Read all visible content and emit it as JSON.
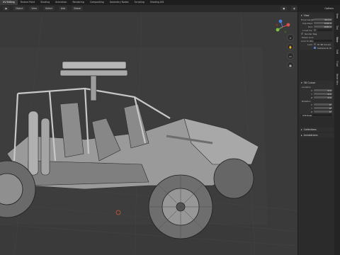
{
  "topbar": {
    "tabs": [
      "UV Editing",
      "Texture Paint",
      "Shading",
      "Animation",
      "Rendering",
      "Compositing",
      "Geometry Nodes",
      "Scripting",
      "Shading.001"
    ],
    "active_index": 0
  },
  "viewport_header": {
    "mode": "Global",
    "chips": [
      "Object",
      "View",
      "Select",
      "Add"
    ]
  },
  "npanel": {
    "header": "Options",
    "view": {
      "title": "View",
      "focal_length_label": "Focal Length",
      "focal_length": "50 mm",
      "clip_start_label": "Clip Start",
      "clip_start": "0.01 m",
      "clip_end_label": "End",
      "clip_end": "1000 m",
      "local_camera_label": "Local Ca.",
      "render_region_label": "Render Reg.",
      "view_lock_label": "View Lock",
      "lock_to_object_label": "Lock to Obj.",
      "lock_label": "Lock",
      "to_3d_cursor_label": "To 3D Cursor",
      "camera_to_view_label": "Camera to Vi."
    },
    "cursor": {
      "title": "3D Cursor",
      "location_label": "Location",
      "x_label": "X",
      "x": "0 m",
      "y_label": "Y",
      "y": "0 m",
      "z_label": "Z",
      "z": "0 m",
      "rotation_label": "Rotation",
      "rx": "0°",
      "ry": "0°",
      "rz": "0°",
      "mode": "XYZ Euler"
    },
    "collections_title": "Collections",
    "annotations_title": "Annotations"
  },
  "sidetabs": [
    "Item",
    "Tool",
    "View",
    "Edit",
    "Fluid",
    "Node Wra."
  ],
  "colors": {
    "accent": "#5680c2",
    "background": "#393939",
    "gizmo_x": "#e0504a",
    "gizmo_y": "#7fbf3f",
    "gizmo_z": "#4a7fe0"
  }
}
